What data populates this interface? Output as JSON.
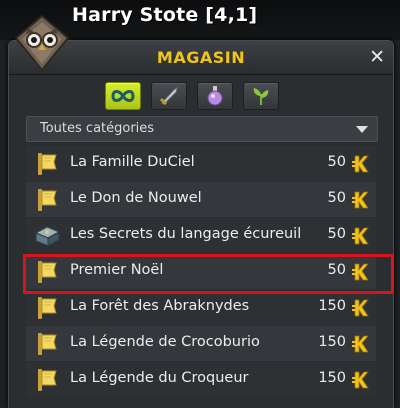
{
  "player": {
    "name": "Harry Stote [4,1]"
  },
  "shop": {
    "title": "MAGASIN",
    "close_icon": "close-icon",
    "tabs": [
      {
        "icon": "infinity-icon",
        "active": true
      },
      {
        "icon": "sword-icon",
        "active": false
      },
      {
        "icon": "potion-icon",
        "active": false
      },
      {
        "icon": "plant-icon",
        "active": false
      }
    ],
    "category": {
      "selected": "Toutes catégories"
    },
    "items": [
      {
        "name": "La Famille DuCiel",
        "price": "50",
        "icon": "scroll-icon"
      },
      {
        "name": "Le Don de Nouwel",
        "price": "50",
        "icon": "scroll-icon"
      },
      {
        "name": "Les Secrets du langage écureuil",
        "price": "50",
        "icon": "book-icon",
        "highlighted": true
      },
      {
        "name": "Premier Noël",
        "price": "50",
        "icon": "scroll-icon"
      },
      {
        "name": "La Forêt des Abraknydes",
        "price": "150",
        "icon": "scroll-icon"
      },
      {
        "name": "La Légende de Crocoburio",
        "price": "150",
        "icon": "scroll-icon"
      },
      {
        "name": "La Légende du Croqueur",
        "price": "150",
        "icon": "scroll-icon"
      }
    ],
    "currency_icon": "kama-icon",
    "colors": {
      "title": "#f0c51a",
      "active_tab": "#c6dd1f",
      "highlight": "#d8151c"
    }
  }
}
